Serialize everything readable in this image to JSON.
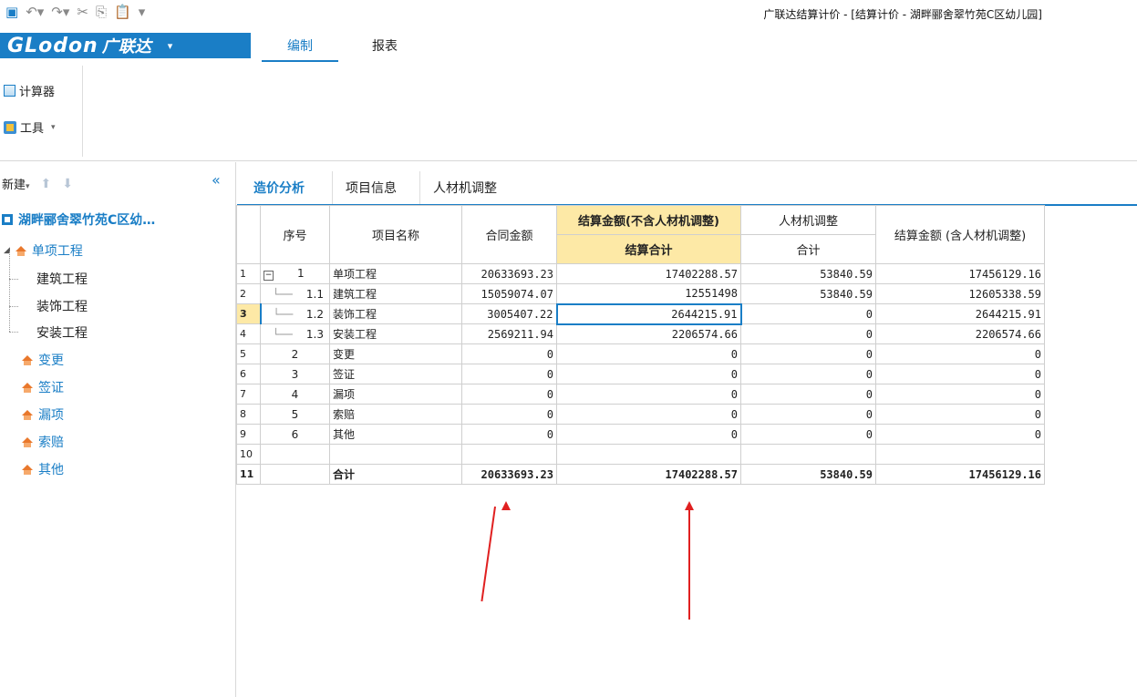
{
  "window_title": "广联达结算计价 - [结算计价 - 湖畔郦舍翠竹苑C区幼儿园]",
  "brand": {
    "logo": "GLodon",
    "logo_cn": "广联达",
    "caret": "▾"
  },
  "ribbon_tabs": [
    "编制",
    "报表"
  ],
  "ribbon_buttons": {
    "calculator": "计算器",
    "tools": "工具"
  },
  "left_toolbar": {
    "new": "新建",
    "up": "⬆",
    "down": "⬇",
    "collapse": "«"
  },
  "tree": {
    "project": "湖畔郦舍翠竹苑C区幼…",
    "single_project": "单项工程",
    "children": [
      "建筑工程",
      "装饰工程",
      "安装工程"
    ],
    "others": [
      "变更",
      "签证",
      "漏项",
      "索赔",
      "其他"
    ]
  },
  "content_tabs": [
    "造价分析",
    "项目信息",
    "人材机调整"
  ],
  "table": {
    "headers": {
      "seq": "序号",
      "name": "项目名称",
      "contract": "合同金额",
      "settle_excl": "结算金额(不含人材机调整)",
      "settle_total": "结算合计",
      "adjust": "人材机调整",
      "adjust_total": "合计",
      "settle_incl": "结算金额 (含人材机调整)"
    },
    "rows": [
      {
        "rn": "1",
        "seq": "1",
        "name": "单项工程",
        "contract": "20633693.23",
        "settle": "17402288.57",
        "adjust": "53840.59",
        "incl": "17456129.16"
      },
      {
        "rn": "2",
        "seq": "1.1",
        "name": "建筑工程",
        "contract": "15059074.07",
        "settle": "12551498",
        "adjust": "53840.59",
        "incl": "12605338.59"
      },
      {
        "rn": "3",
        "seq": "1.2",
        "name": "装饰工程",
        "contract": "3005407.22",
        "settle": "2644215.91",
        "adjust": "0",
        "incl": "2644215.91"
      },
      {
        "rn": "4",
        "seq": "1.3",
        "name": "安装工程",
        "contract": "2569211.94",
        "settle": "2206574.66",
        "adjust": "0",
        "incl": "2206574.66"
      },
      {
        "rn": "5",
        "seq": "2",
        "name": "变更",
        "contract": "0",
        "settle": "0",
        "adjust": "0",
        "incl": "0"
      },
      {
        "rn": "6",
        "seq": "3",
        "name": "签证",
        "contract": "0",
        "settle": "0",
        "adjust": "0",
        "incl": "0"
      },
      {
        "rn": "7",
        "seq": "4",
        "name": "漏项",
        "contract": "0",
        "settle": "0",
        "adjust": "0",
        "incl": "0"
      },
      {
        "rn": "8",
        "seq": "5",
        "name": "索赔",
        "contract": "0",
        "settle": "0",
        "adjust": "0",
        "incl": "0"
      },
      {
        "rn": "9",
        "seq": "6",
        "name": "其他",
        "contract": "0",
        "settle": "0",
        "adjust": "0",
        "incl": "0"
      },
      {
        "rn": "10",
        "seq": "",
        "name": "",
        "contract": "",
        "settle": "",
        "adjust": "",
        "incl": ""
      },
      {
        "rn": "11",
        "seq": "",
        "name": "合计",
        "contract": "20633693.23",
        "settle": "17402288.57",
        "adjust": "53840.59",
        "incl": "17456129.16"
      }
    ]
  },
  "colors": {
    "accent": "#1a7ec6",
    "highlight": "#fde9a6",
    "annotation": "#e02020"
  }
}
